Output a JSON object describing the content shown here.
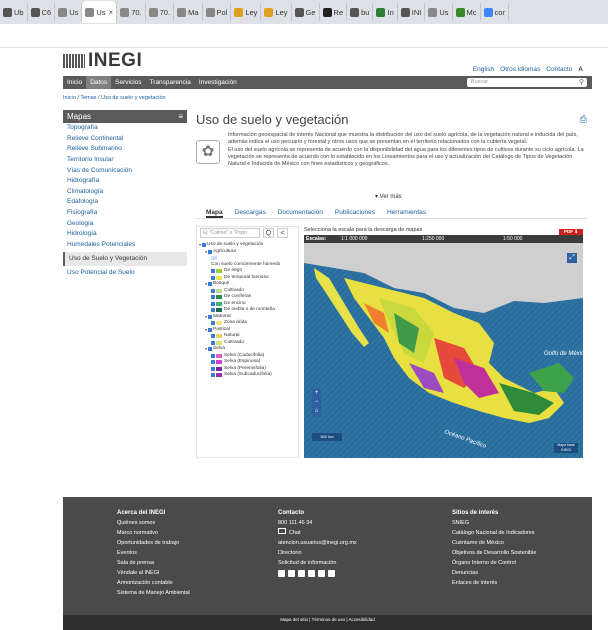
{
  "browser": {
    "tabs": [
      {
        "label": "Ub",
        "icon": "tab-icon",
        "color": "#555"
      },
      {
        "label": "C6",
        "icon": "globe-icon",
        "color": "#555"
      },
      {
        "label": "Us",
        "icon": "inegi-icon",
        "color": "#888"
      },
      {
        "label": "Us",
        "icon": "inegi-icon",
        "color": "#888",
        "active": true
      },
      {
        "label": "70.",
        "icon": "inegi-icon",
        "color": "#888"
      },
      {
        "label": "70.",
        "icon": "inegi-icon",
        "color": "#888"
      },
      {
        "label": "Ma",
        "icon": "inegi-icon",
        "color": "#888"
      },
      {
        "label": "Pol",
        "icon": "inegi-icon",
        "color": "#888"
      },
      {
        "label": "Ley",
        "icon": "leaf-icon",
        "color": "#e0a020"
      },
      {
        "label": "Ley",
        "icon": "leaf-icon",
        "color": "#e0a020"
      },
      {
        "label": "Ge",
        "icon": "globe-icon",
        "color": "#555"
      },
      {
        "label": "Re",
        "icon": "globe-icon",
        "color": "#222"
      },
      {
        "label": "bu",
        "icon": "globe-icon",
        "color": "#555"
      },
      {
        "label": "In",
        "icon": "grid-icon",
        "color": "#2e7d32"
      },
      {
        "label": "INI",
        "icon": "doc-icon",
        "color": "#555"
      },
      {
        "label": "Us",
        "icon": "inegi-icon",
        "color": "#888"
      },
      {
        "label": "Mc",
        "icon": "feather-icon",
        "color": "#3a8a2a"
      },
      {
        "label": "cor",
        "icon": "google-icon",
        "color": "#4285f4"
      }
    ]
  },
  "header": {
    "logo_text": "INEGI",
    "top_links": [
      "English",
      "Otros idiomas",
      "Contacto"
    ],
    "aa": "A",
    "nav": [
      "Inicio",
      "Datos",
      "Servicios",
      "Transparencia",
      "Investigación"
    ],
    "nav_active": 1,
    "search_placeholder": "Buscar",
    "breadcrumb": "Inicio / Temas / Uso de suelo y vegetación"
  },
  "sidebar": {
    "title": "Mapas",
    "items": [
      "Topografía",
      "Relieve Continental",
      "Relieve Submarino",
      "Territorio Insular",
      "Vías de Comunicación",
      "Hidrografía",
      "Climatología",
      "Edafología",
      "Fisiografía",
      "Geología",
      "Hidrología",
      "Humedales Potenciales",
      "Uso de Suelo y Vegetación",
      "Uso Potencial de Suelo"
    ],
    "selected_index": 12
  },
  "main": {
    "title": "Uso de suelo y vegetación",
    "intro_1": "Información geoespacial de interés Nacional que muestra la distribución del uso del suelo agrícola, de la vegetación natural e inducida del país, además indica el uso pecuario y forestal y otros usos que se presentan en el territorio relacionados con la cubierta vegetal.",
    "intro_2": "El uso del suelo agrícola se representa de acuerdo con la disponibilidad del agua para los diferentes tipos de cultivos durante su ciclo agrícola. La vegetación se representa de acuerdo con lo establecido en los Lineamientos para el uso y actualización del Catálogo de Tipos de Vegetación Natural e Inducida de México con fines estadísticos y geográficos.",
    "ver_mas": "▾ Ver más",
    "tabs": [
      "Mapa",
      "Descargas",
      "Documentación",
      "Publicaciones",
      "Herramientas"
    ],
    "active_tab": 0
  },
  "tree": {
    "search_placeholder": "Ej \"Colima\" o \"Popo",
    "search_btn": "Q",
    "back_btn": "<",
    "nodes": [
      {
        "label": "Uso de suelo y vegetación",
        "level": 0,
        "arrow": "▾",
        "cb": true
      },
      {
        "label": "Agricultura",
        "level": 1,
        "arrow": "▾",
        "cb": true
      },
      {
        "label": "",
        "level": 2,
        "swatch": "#cfe0f7"
      },
      {
        "label": "Con suelo comúnmente húmedo",
        "level": 2
      },
      {
        "label": "De riego",
        "level": 2,
        "swatch": "#9acd32",
        "cb": true
      },
      {
        "label": "De temporal fuerioso",
        "level": 2,
        "swatch": "#e8e84a",
        "cb": true
      },
      {
        "label": "Bosque",
        "level": 1,
        "arrow": "▾",
        "cb": true
      },
      {
        "label": "Cultivado",
        "level": 2,
        "swatch": "#b8e08a",
        "cb": true
      },
      {
        "label": "De coníferas",
        "level": 2,
        "swatch": "#2e8b57",
        "cb": true
      },
      {
        "label": "De encino",
        "level": 2,
        "swatch": "#3cb371",
        "cb": true
      },
      {
        "label": "De niebla o de montaña",
        "level": 2,
        "swatch": "#1e6b4a",
        "cb": true
      },
      {
        "label": "Matorral",
        "level": 1,
        "arrow": "▾",
        "cb": true
      },
      {
        "label": "Zona árida",
        "level": 2,
        "swatch": "#f3e37a",
        "cb": true
      },
      {
        "label": "Pastizal",
        "level": 1,
        "arrow": "▾",
        "cb": true
      },
      {
        "label": "Natural",
        "level": 2,
        "swatch": "#f0d060",
        "cb": true
      },
      {
        "label": "Cultivado",
        "level": 2,
        "swatch": "#d6e86a",
        "cb": true
      },
      {
        "label": "Selva",
        "level": 1,
        "arrow": "▾",
        "cb": true
      },
      {
        "label": "Selva (Caducifolia)",
        "level": 2,
        "swatch": "#e060c0",
        "cb": true
      },
      {
        "label": "Selva (Espinosa)",
        "level": 2,
        "swatch": "#d040d0",
        "cb": true
      },
      {
        "label": "Selva (Perennifolia)",
        "level": 2,
        "swatch": "#7a2a9a",
        "cb": true
      },
      {
        "label": "Selva (Subcaducifolia)",
        "level": 2,
        "swatch": "#a030b0",
        "cb": true
      }
    ]
  },
  "map": {
    "header": "Selecciona la escala para la descarga de mapas",
    "pdf": "PDF ⬇",
    "scale_label": "Escalas:",
    "scales": [
      "1:1 000 000",
      "1:250 000",
      "1:50 000"
    ],
    "gulf_label": "Golfo de México",
    "pacific_label": "Océano Pacífico",
    "scalebar": "500 km",
    "copyright": "Mapa base INEGI"
  },
  "footer": {
    "col1_title": "Acerca del INEGI",
    "col1": [
      "Quiénes somos",
      "Marco normativo",
      "Oportunidades de trabajo",
      "Eventos",
      "Sala de prensa",
      "Véndale al INEGI",
      "Armonización contable",
      "Sistema de Manejo Ambiental"
    ],
    "col2_title": "Contacto",
    "phone": "800 111 46 34",
    "chat": "Chat",
    "email": "atencion.usuarios@inegi.org.mx",
    "col2": [
      "Directorio",
      "Solicitud de información"
    ],
    "col3_title": "Sitios de interés",
    "col3": [
      "SNIEG",
      "Catálogo Nacional de Indicadores",
      "Cuéntame de México",
      "Objetivos de Desarrollo Sostenible",
      "Órgano Interno de Control",
      "Denuncias",
      "Enlaces de interés"
    ],
    "bottom": "Mapa del sitio | Términos de uso | Accesibilidad"
  }
}
